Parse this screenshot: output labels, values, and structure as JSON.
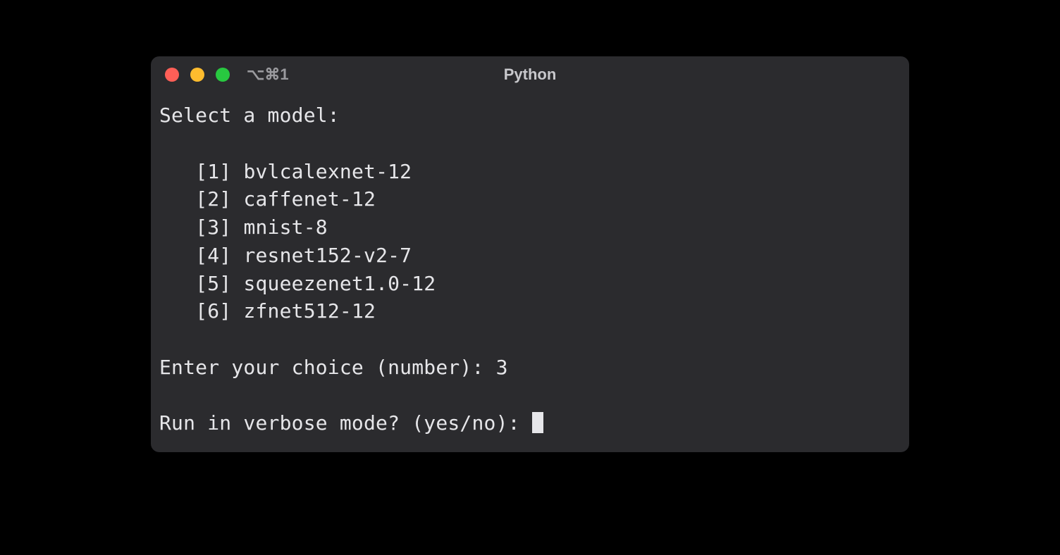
{
  "window": {
    "title": "Python",
    "shortcut": "⌥⌘1"
  },
  "terminal": {
    "promptHeader": "Select a model:",
    "models": [
      {
        "index": "[1]",
        "name": "bvlcalexnet-12"
      },
      {
        "index": "[2]",
        "name": "caffenet-12"
      },
      {
        "index": "[3]",
        "name": "mnist-8"
      },
      {
        "index": "[4]",
        "name": "resnet152-v2-7"
      },
      {
        "index": "[5]",
        "name": "squeezenet1.0-12"
      },
      {
        "index": "[6]",
        "name": "zfnet512-12"
      }
    ],
    "choicePrompt": "Enter your choice (number): ",
    "choiceValue": "3",
    "verbosePrompt": "Run in verbose mode? (yes/no): "
  }
}
